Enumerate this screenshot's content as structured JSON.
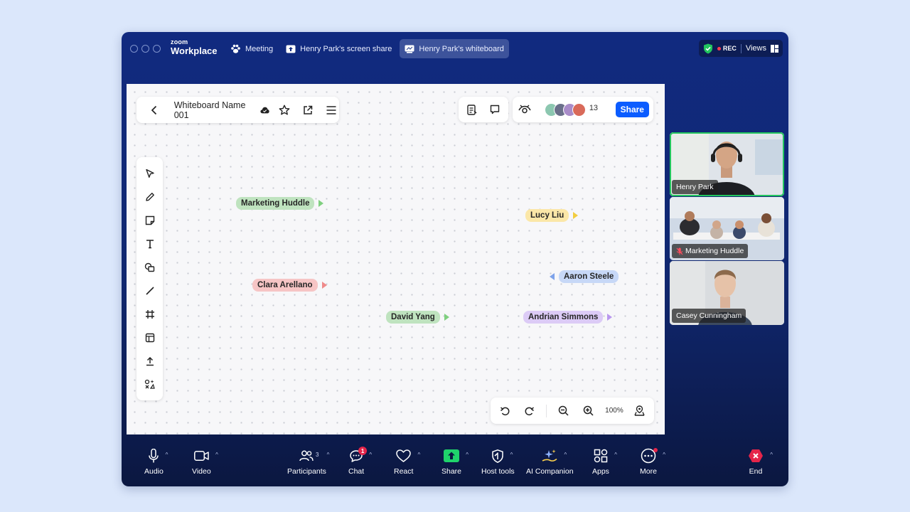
{
  "app": {
    "brand_small": "zoom",
    "brand_big": "Workplace"
  },
  "tabs": [
    {
      "label": "Meeting",
      "icon": "paw-icon",
      "active": false
    },
    {
      "label": "Henry Park's screen share",
      "icon": "screen-share-icon",
      "active": false
    },
    {
      "label": "Henry Park's whiteboard",
      "icon": "whiteboard-icon",
      "active": true
    }
  ],
  "status": {
    "rec": "REC",
    "views": "Views"
  },
  "whiteboard": {
    "name": "Whiteboard Name 001",
    "participant_count": "13",
    "share_label": "Share",
    "zoom_level": "100%"
  },
  "cursors": [
    {
      "label": "Marketing Huddle",
      "color": "#bfe3bf",
      "arrow": "#7fcf7f"
    },
    {
      "label": "Lucy Liu",
      "color": "#fbe7a8",
      "arrow": "#f2cd40"
    },
    {
      "label": "Aaron Steele",
      "color": "#c7d8f7",
      "arrow": "#7ea3ea"
    },
    {
      "label": "Clara Arellano",
      "color": "#f6c5c5",
      "arrow": "#ef8a8a"
    },
    {
      "label": "David Yang",
      "color": "#bfe3bf",
      "arrow": "#7fcf7f"
    },
    {
      "label": "Andrian Simmons",
      "color": "#dccbf6",
      "arrow": "#b997ee"
    }
  ],
  "videos": [
    {
      "name": "Henry Park",
      "active": true,
      "muted": false
    },
    {
      "name": "Marketing Huddle",
      "active": false,
      "muted": true
    },
    {
      "name": "Casey Cunningham",
      "active": false,
      "muted": false
    }
  ],
  "controls": {
    "audio": "Audio",
    "video": "Video",
    "participants": "Participants",
    "participants_count": "3",
    "chat": "Chat",
    "chat_badge": "1",
    "react": "React",
    "share": "Share",
    "host_tools": "Host tools",
    "ai_companion": "AI Companion",
    "apps": "Apps",
    "more": "More",
    "end": "End"
  },
  "colors": {
    "accent": "#0b5cff",
    "window": "#112a80",
    "end": "#e5254a"
  }
}
